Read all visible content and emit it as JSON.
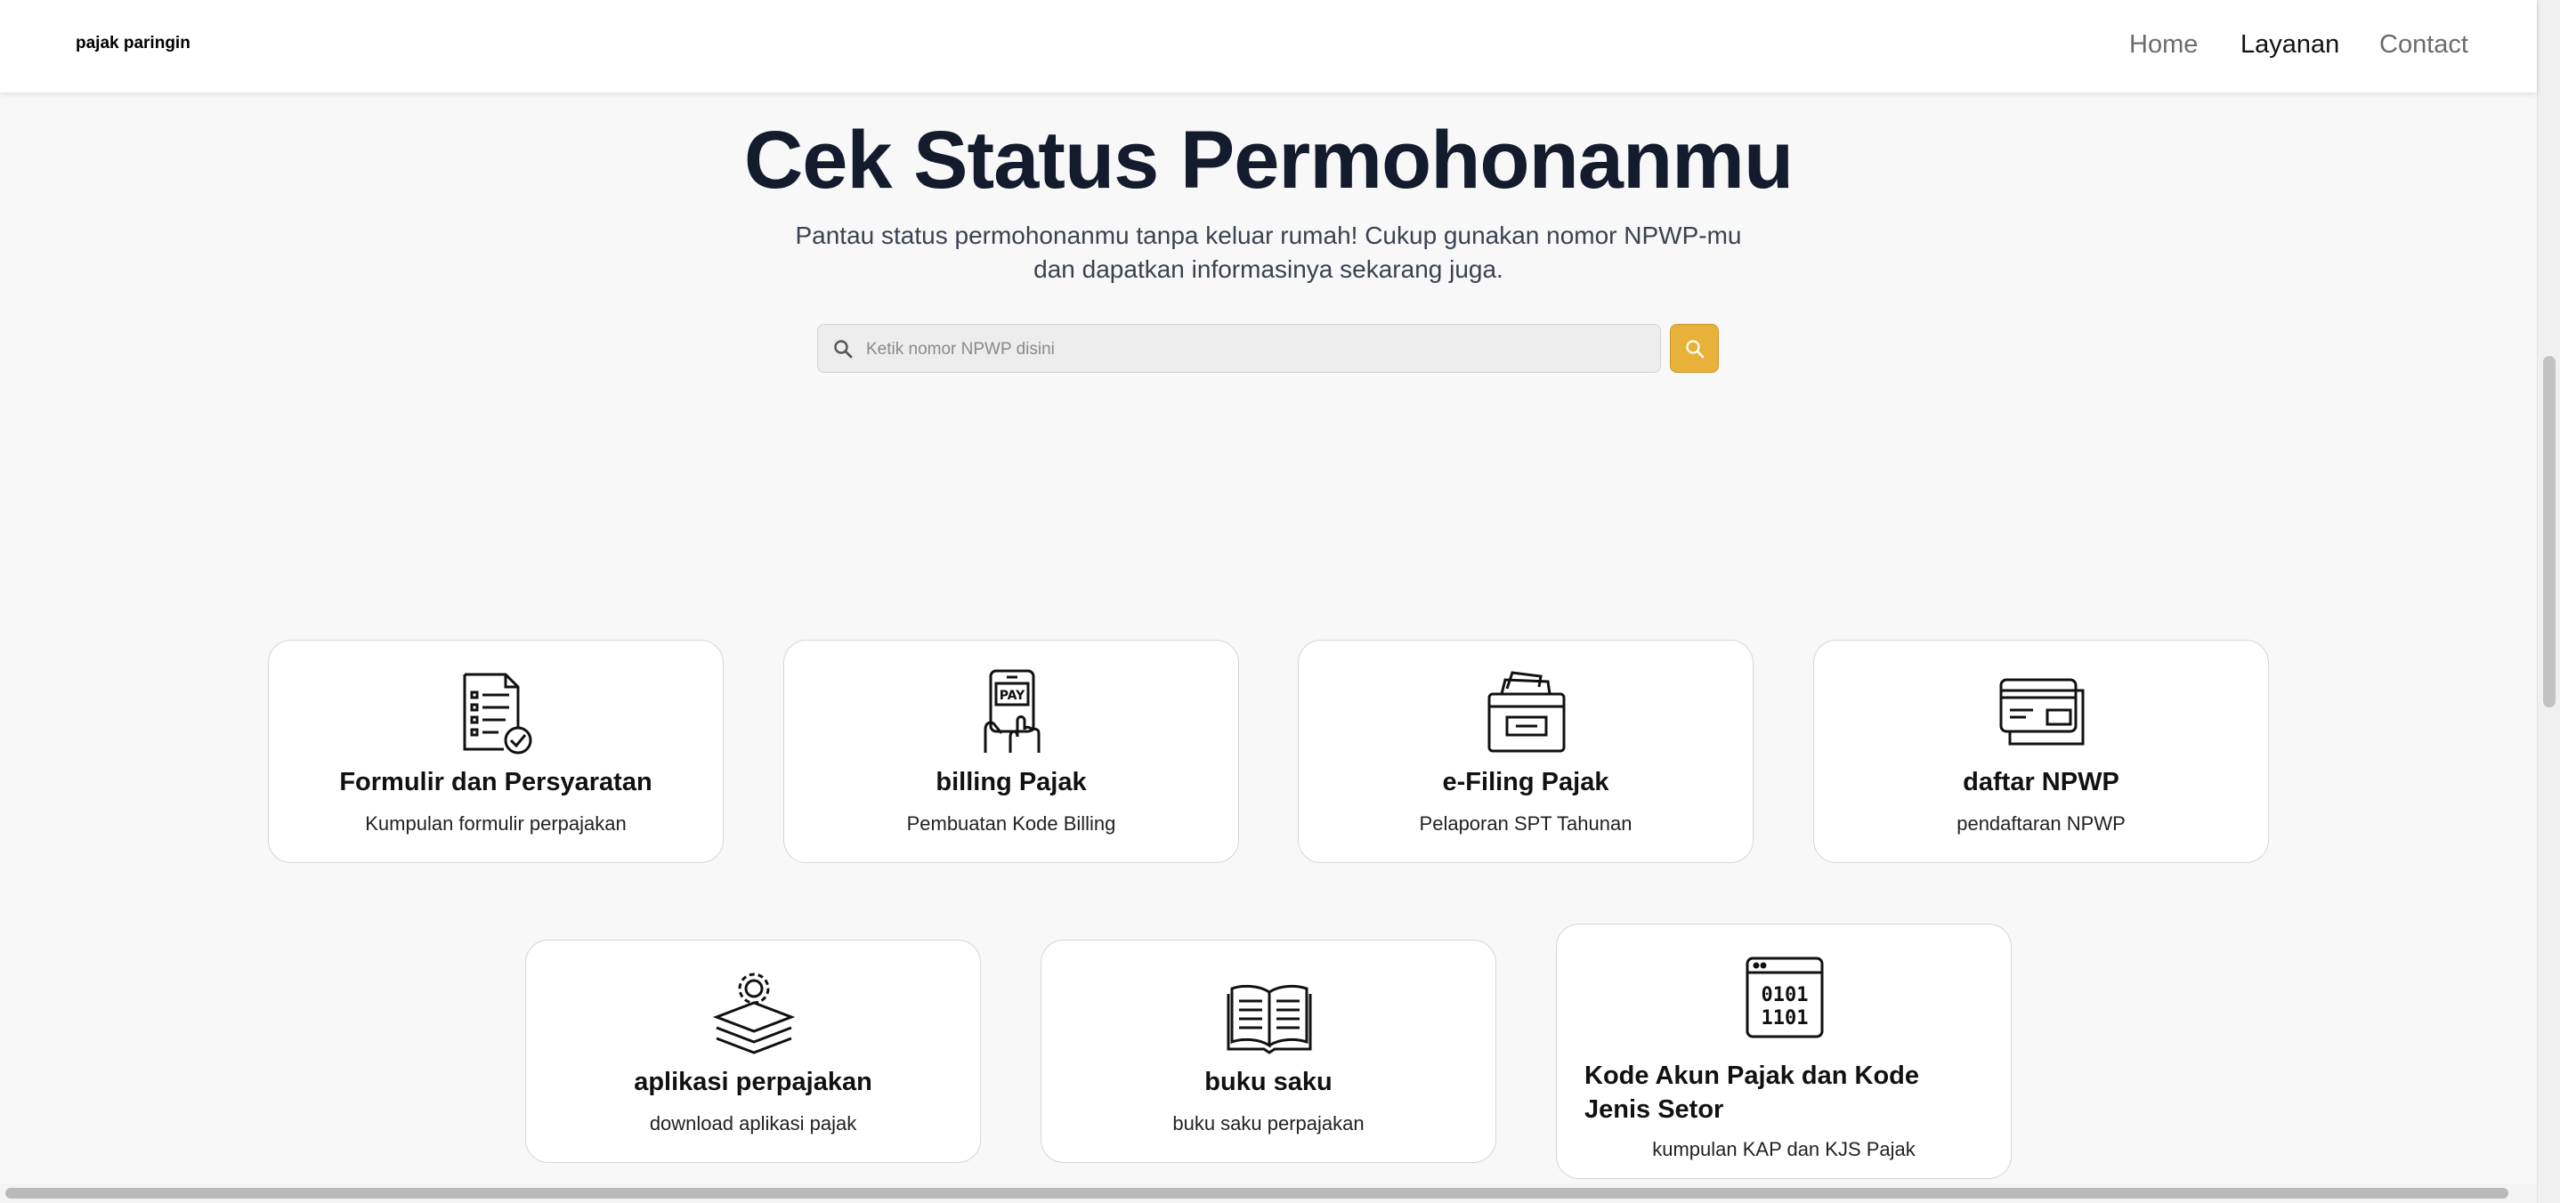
{
  "navbar": {
    "brand": "pajak paringin",
    "links": [
      {
        "label": "Home",
        "active": false
      },
      {
        "label": "Layanan",
        "active": true
      },
      {
        "label": "Contact",
        "active": false
      }
    ]
  },
  "hero": {
    "title": "Cek Status Permohonanmu",
    "subtitle": "Pantau status permohonanmu tanpa keluar rumah! Cukup gunakan nomor NPWP-mu dan dapatkan informasinya sekarang juga."
  },
  "search": {
    "placeholder": "Ketik nomor NPWP disini",
    "value": "",
    "icon": "search-icon",
    "button_icon": "search-icon",
    "button_color": "#e8b23a"
  },
  "services": [
    {
      "title": "Formulir dan Persyaratan",
      "description": "Kumpulan formulir perpajakan",
      "icon": "document-check-icon"
    },
    {
      "title": "billing Pajak",
      "description": "Pembuatan Kode Billing",
      "icon": "phone-pay-icon"
    },
    {
      "title": "e-Filing Pajak",
      "description": "Pelaporan SPT Tahunan",
      "icon": "file-box-icon"
    },
    {
      "title": "daftar NPWP",
      "description": "pendaftaran NPWP",
      "icon": "card-icon"
    },
    {
      "title": "aplikasi perpajakan",
      "description": "download aplikasi pajak",
      "icon": "gear-layers-icon"
    },
    {
      "title": "buku saku",
      "description": "buku saku perpajakan",
      "icon": "open-book-icon"
    },
    {
      "title": "Kode Akun Pajak dan Kode Jenis Setor",
      "description": "kumpulan KAP dan KJS Pajak",
      "icon": "binary-code-icon"
    }
  ],
  "colors": {
    "accent": "#e8b23a",
    "heading": "#141b2d",
    "background": "#f8f8f8"
  }
}
